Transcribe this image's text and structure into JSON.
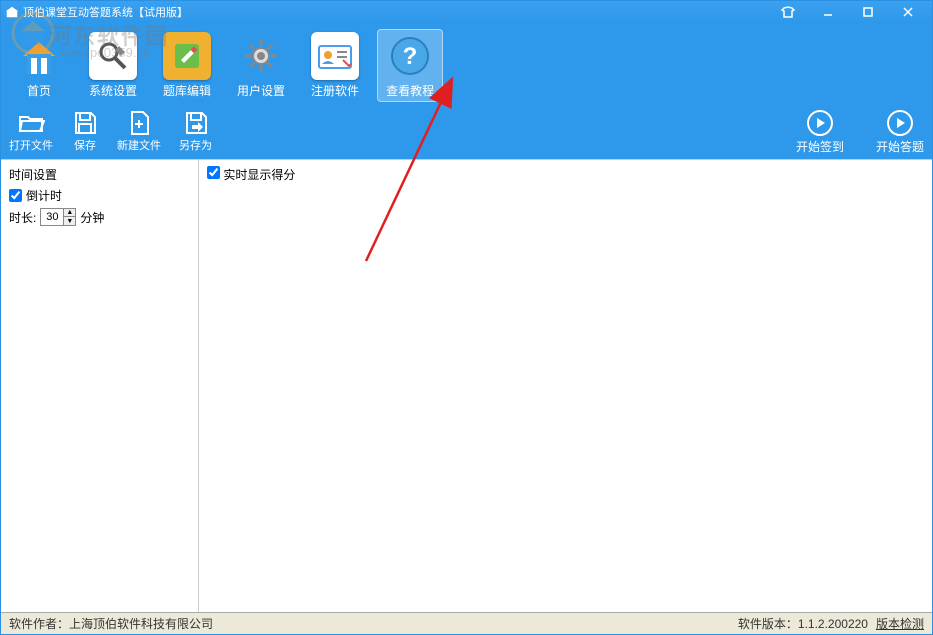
{
  "window": {
    "title": "顶伯课堂互动答题系统【试用版】"
  },
  "mainToolbar": {
    "home": "首页",
    "systemSettings": "系统设置",
    "questionBankEdit": "题库编辑",
    "userSettings": "用户设置",
    "registerSoftware": "注册软件",
    "viewTutorial": "查看教程"
  },
  "subToolbar": {
    "openFile": "打开文件",
    "save": "保存",
    "newFile": "新建文件",
    "saveAs": "另存为",
    "startCheckin": "开始签到",
    "startAnswer": "开始答题"
  },
  "leftPanel": {
    "timeSettings": "时间设置",
    "countdown": "倒计时",
    "durationLabel": "时长:",
    "durationValue": "30",
    "durationUnit": "分钟"
  },
  "rightPanel": {
    "realtimeScore": "实时显示得分"
  },
  "statusbar": {
    "authorLabel": "软件作者：",
    "authorValue": "上海顶伯软件科技有限公司",
    "versionLabel": "软件版本：",
    "versionValue": "1.1.2.200220",
    "versionCheck": "版本检测"
  },
  "watermark": {
    "text": "河东软件园",
    "url": "www.pc0359.cn"
  }
}
